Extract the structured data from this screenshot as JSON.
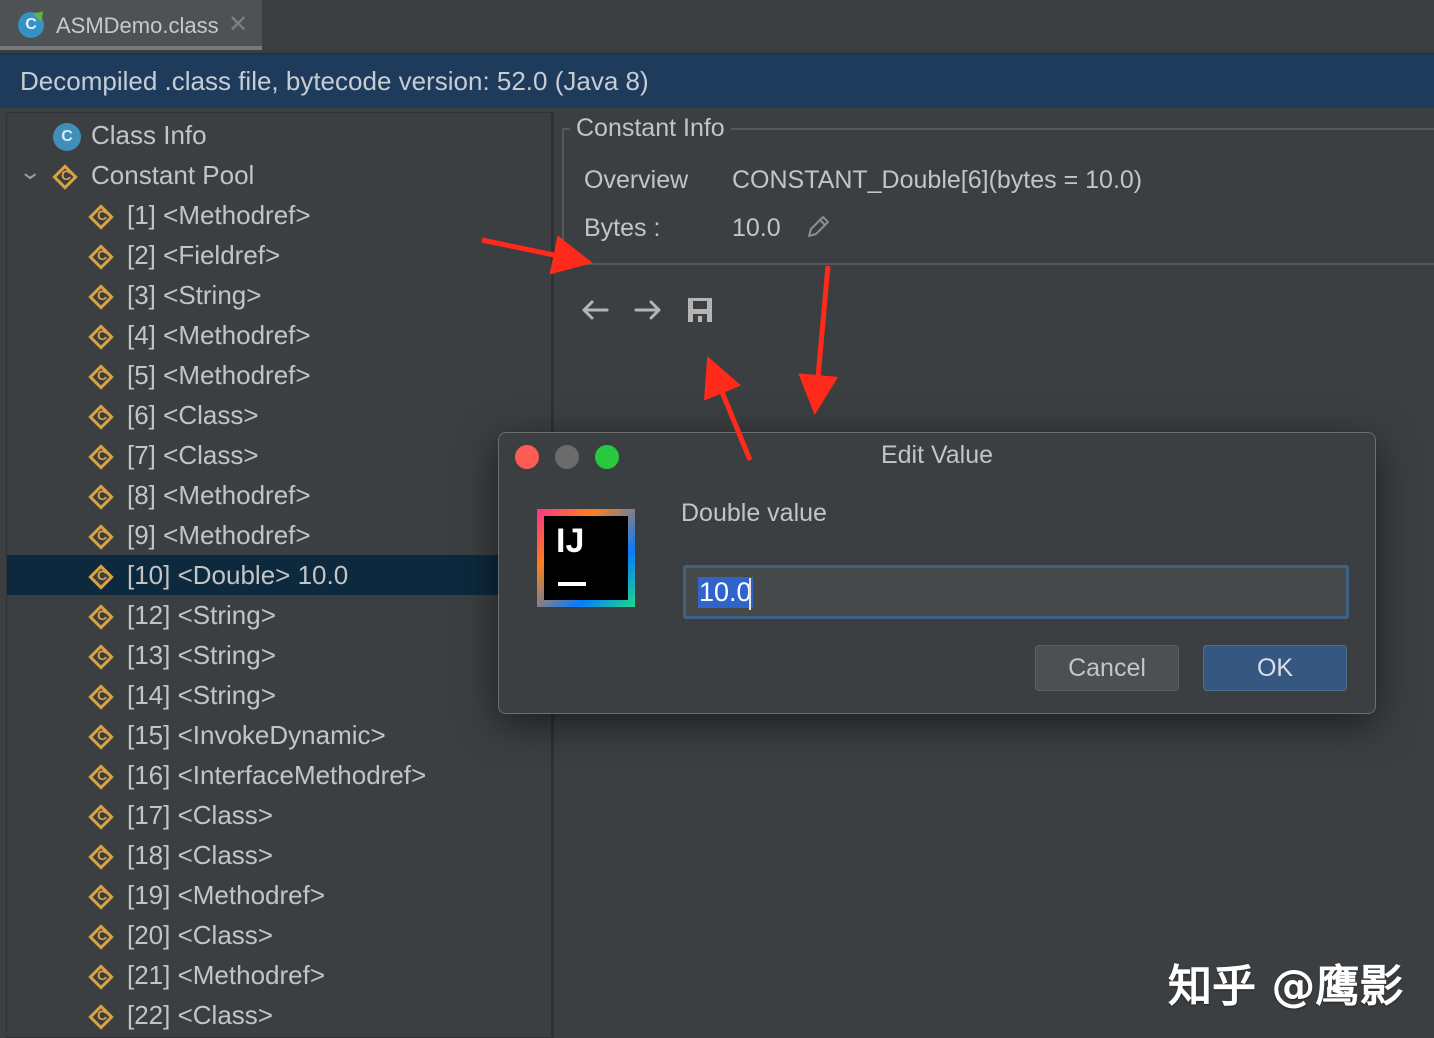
{
  "tab": {
    "icon_letter": "C",
    "title": "ASMDemo.class",
    "close": "✕"
  },
  "banner": {
    "text": "Decompiled .class file, bytecode version: 52.0 (Java 8)"
  },
  "tree": {
    "class_info": {
      "icon_letter": "C",
      "label": "Class Info"
    },
    "constant_pool": {
      "expand": "⌄",
      "icon_letter": "C",
      "label": "Constant Pool"
    },
    "items": [
      "[1] <Methodref>",
      "[2] <Fieldref>",
      "[3] <String>",
      "[4] <Methodref>",
      "[5] <Methodref>",
      "[6] <Class>",
      "[7] <Class>",
      "[8] <Methodref>",
      "[9] <Methodref>",
      "[10] <Double> 10.0",
      "[12] <String>",
      "[13] <String>",
      "[14] <String>",
      "[15] <InvokeDynamic>",
      "[16] <InterfaceMethodref>",
      "[17] <Class>",
      "[18] <Class>",
      "[19] <Methodref>",
      "[20] <Class>",
      "[21] <Methodref>",
      "[22] <Class>"
    ],
    "item_icon_letter": "C",
    "selected_item": "[10] <Double> 10.0"
  },
  "constant_info": {
    "legend": "Constant Info",
    "overview_label": "Overview",
    "overview_value": "CONSTANT_Double[6](bytes = 10.0)",
    "bytes_label": "Bytes :",
    "bytes_value": "10.0"
  },
  "dialog": {
    "title": "Edit Value",
    "logo_text": "IJ",
    "prompt": "Double value",
    "input_value": "10.0",
    "cancel_label": "Cancel",
    "ok_label": "OK"
  },
  "watermark": "知乎 @鹰影",
  "colors": {
    "accent_red": "#ff2a1a",
    "selection": "#0d293e",
    "banner": "#1f3b5c",
    "ok_button": "#365880"
  }
}
